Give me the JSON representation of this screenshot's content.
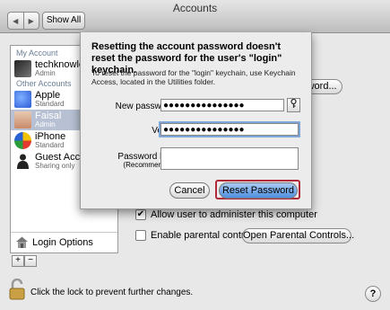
{
  "window": {
    "title": "Accounts"
  },
  "toolbar": {
    "back_glyph": "◀",
    "forward_glyph": "▶",
    "show_all_label": "Show All"
  },
  "sidebar": {
    "my_account_header": "My Account",
    "my_account": {
      "name": "techknowled",
      "role": "Admin"
    },
    "other_accounts_header": "Other Accounts",
    "accounts": [
      {
        "name": "Apple",
        "role": "Standard"
      },
      {
        "name": "Faisal",
        "role": "Admin"
      },
      {
        "name": "iPhone",
        "role": "Standard"
      },
      {
        "name": "Guest Accou",
        "role": "Sharing only"
      }
    ],
    "login_options_label": "Login Options",
    "add_glyph": "+",
    "remove_glyph": "−"
  },
  "main": {
    "reset_password_partial": "Reset Password...",
    "allow_admin_label": "Allow user to administer this computer",
    "allow_admin_checked": true,
    "parental_controls_label": "Enable parental controls",
    "parental_controls_checked": false,
    "open_parental_label": "Open Parental Controls..."
  },
  "sheet": {
    "heading": "Resetting the account password doesn't reset the password for the user's \"login\" keychain.",
    "body": "To reset the password for the \"login\" keychain, use Keychain Access, located in the Utilities folder.",
    "new_password_label": "New password:",
    "new_password_value": "●●●●●●●●●●●●●●●",
    "verify_label": "Verify:",
    "verify_value": "●●●●●●●●●●●●●●●",
    "hint_label": "Password hint:",
    "hint_sub": "(Recommended)",
    "hint_value": "",
    "key_glyph": "🔑",
    "cancel_label": "Cancel",
    "reset_label": "Reset Password"
  },
  "footer": {
    "lock_text": "Click the lock to prevent further changes.",
    "help_glyph": "?"
  }
}
